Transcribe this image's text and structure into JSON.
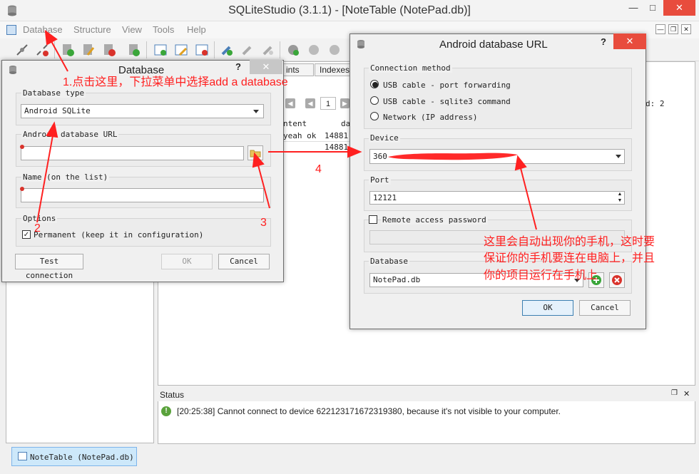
{
  "app": {
    "title": "SQLiteStudio (3.1.1) - [NoteTable (NotePad.db)]",
    "menu": [
      "Database",
      "Structure",
      "View",
      "Tools",
      "Help"
    ]
  },
  "editor": {
    "tabs": [
      "ints",
      "Indexes"
    ],
    "col_content": "ntent",
    "col_date": "da",
    "row1_content": "yeah ok",
    "row1_num": "14881",
    "row2_num": "14881",
    "page_num": "1",
    "count_label": "d: 2"
  },
  "status": {
    "title": "Status",
    "message": "[20:25:38] Cannot connect to device 622123171672319380, because it's not visible to your computer."
  },
  "bottom_tab": {
    "label": "NoteTable (NotePad.db)"
  },
  "db_dialog": {
    "title": "Database",
    "help": "?",
    "type_label": "Database type",
    "type_value": "Android SQLite",
    "url_label": "Android database URL",
    "name_label": "Name (on the list)",
    "options_label": "Options",
    "permanent_label": "Permanent (keep it in configuration)",
    "test_btn": "Test connection",
    "ok_btn": "OK",
    "cancel_btn": "Cancel"
  },
  "url_dialog": {
    "title": "Android database URL",
    "help": "?",
    "conn_label": "Connection method",
    "methods": [
      "USB cable - port forwarding",
      "USB cable - sqlite3 command",
      "Network (IP address)"
    ],
    "device_label": "Device",
    "device_value": "360",
    "port_label": "Port",
    "port_value": "12121",
    "remote_label": "Remote access password",
    "database_label": "Database",
    "database_value": "NotePad.db",
    "ok_btn": "OK",
    "cancel_btn": "Cancel"
  },
  "annotations": {
    "step1": "1.点击这里，下拉菜单中选择add a database",
    "n2": "2",
    "n3": "3",
    "n4": "4",
    "note_line1": "这里会自动出现你的手机，这时要",
    "note_line2": "保证你的手机要连在电脑上，并且",
    "note_line3": "你的项目运行在手机上"
  },
  "colors": {
    "annotation": "#ff2020",
    "accent": "#3c7fb1",
    "error": "#d9322b",
    "ok": "#3aa63a"
  }
}
